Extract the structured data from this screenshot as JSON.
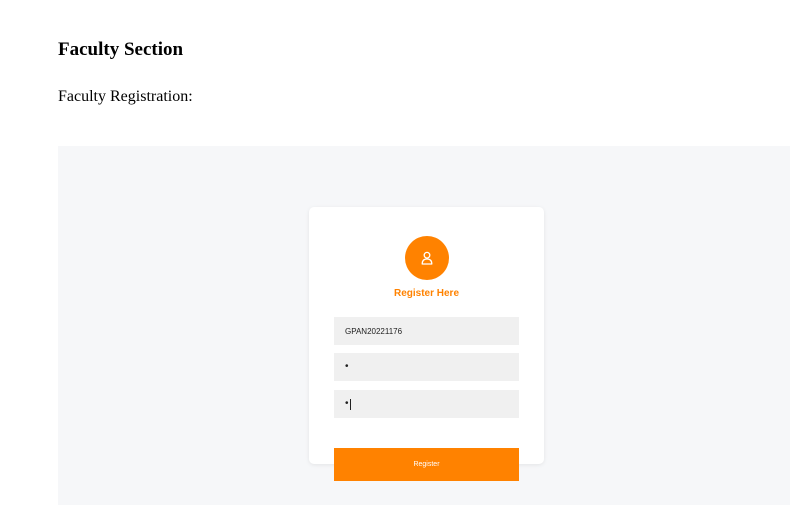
{
  "page": {
    "section_title": "Faculty Section",
    "section_subtitle": "Faculty Registration:"
  },
  "form": {
    "title": "Register Here",
    "icon": "user-icon",
    "fields": [
      {
        "value": "GPAN20221176",
        "type": "text"
      },
      {
        "value": "•",
        "type": "password"
      },
      {
        "value": "•",
        "type": "password",
        "focused": true
      }
    ],
    "submit_label": "Register"
  },
  "colors": {
    "accent": "#ff8200",
    "panel_background": "#f6f7f9",
    "field_background": "#f0f0f0"
  }
}
